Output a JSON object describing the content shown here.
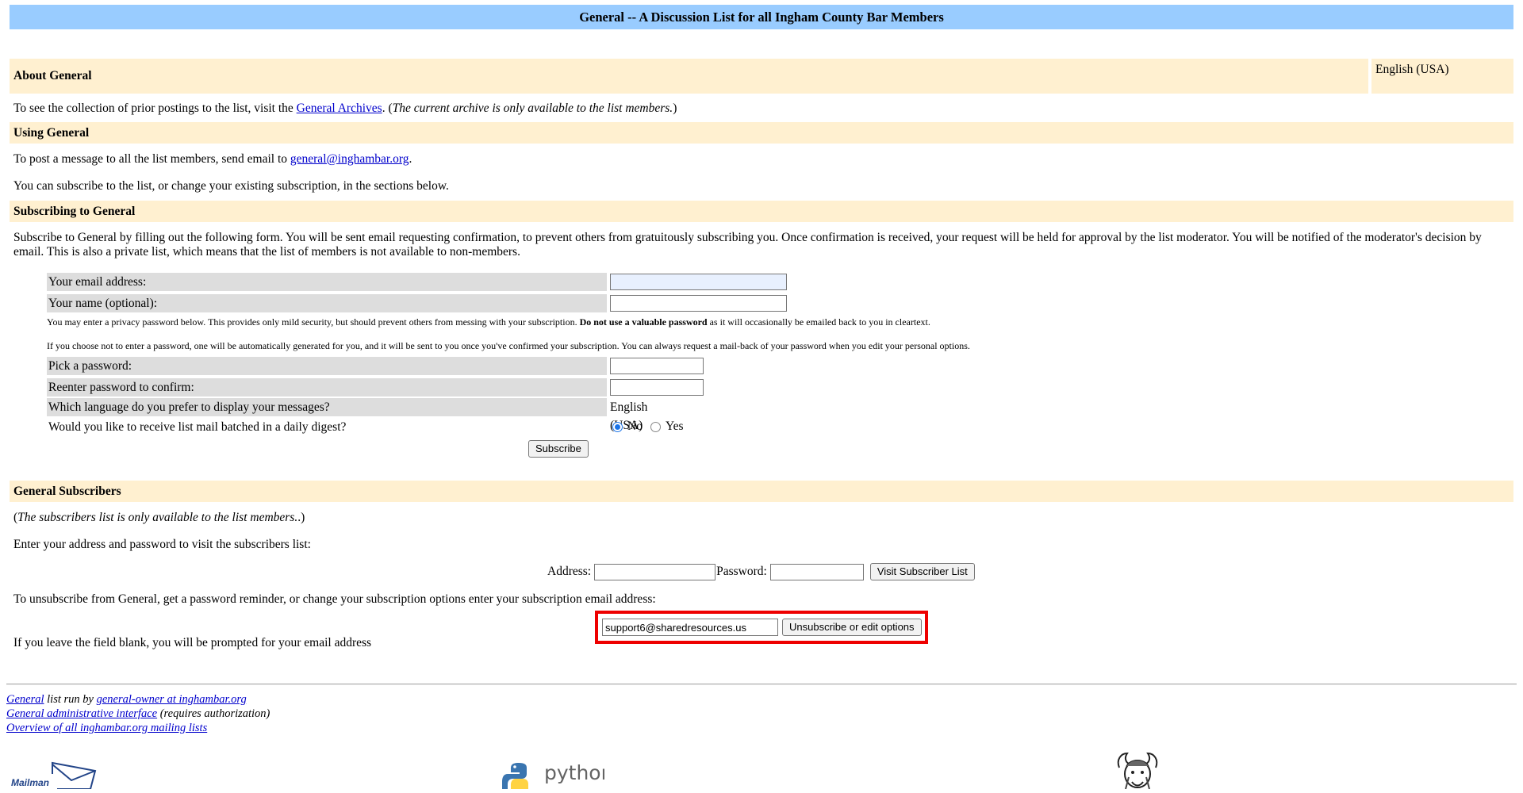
{
  "page": {
    "title": "General -- A Discussion List for all Ingham County Bar Members"
  },
  "about": {
    "heading": "About General",
    "language": "English (USA)",
    "archive_text_pre": "To see the collection of prior postings to the list, visit the ",
    "archive_link": "General Archives",
    "archive_text_post": ". (",
    "archive_note": "The current archive is only available to the list members.",
    "archive_close": ")"
  },
  "using": {
    "heading": "Using General",
    "post_pre": "To post a message to all the list members, send email to ",
    "post_email": "general@inghambar.org",
    "post_post": ".",
    "subscribe_info": "You can subscribe to the list, or change your existing subscription, in the sections below."
  },
  "subscribing": {
    "heading": "Subscribing to General",
    "intro": "Subscribe to General by filling out the following form. You will be sent email requesting confirmation, to prevent others from gratuitously subscribing you. Once confirmation is received, your request will be held for approval by the list moderator. You will be notified of the moderator's decision by email. This is also a private list, which means that the list of members is not available to non-members.",
    "email_label": "Your email address:",
    "email_value": "",
    "name_label": "Your name (optional):",
    "name_value": "",
    "privacy_note_pre": "You may enter a privacy password below. This provides only mild security, but should prevent others from messing with your subscription. ",
    "privacy_note_bold": "Do not use a valuable password",
    "privacy_note_post": " as it will occasionally be emailed back to you in cleartext.",
    "auto_password_note": "If you choose not to enter a password, one will be automatically generated for you, and it will be sent to you once you've confirmed your subscription. You can always request a mail-back of your password when you edit your personal options.",
    "password_label": "Pick a password:",
    "confirm_label": "Reenter password to confirm:",
    "language_label": "Which language do you prefer to display your messages?",
    "language_value": "English (USA)",
    "digest_label": "Would you like to receive list mail batched in a daily digest?",
    "digest_no": "No",
    "digest_yes": "Yes",
    "subscribe_button": "Subscribe"
  },
  "subscribers": {
    "heading": "General Subscribers",
    "private_note": "The subscribers list is only available to the list members.",
    "paren_open": "(",
    "paren_close": ".)",
    "enter_text": "Enter your address and password to visit the subscribers list:",
    "address_label": "Address:",
    "password_label": "Password:",
    "visit_button": "Visit Subscriber List",
    "unsub_text": "To unsubscribe from General, get a password reminder, or change your subscription options enter your subscription email address:",
    "unsub_email_value": "support6@sharedresources.us",
    "unsub_button": "Unsubscribe or edit options",
    "blank_note": "If you leave the field blank, you will be prompted for your email address"
  },
  "footer": {
    "list_link": "General",
    "run_by": " list run by ",
    "owner_link": "general-owner at inghambar.org",
    "admin_link": "General administrative interface",
    "admin_note": " (requires authorization)",
    "overview_link": "Overview of all inghambar.org mailing lists"
  },
  "logos": {
    "mailman_text": "Mailman",
    "python_text": "python"
  },
  "colors": {
    "title_bg": "#99ccff",
    "section_bg": "#fff0d0",
    "label_bg": "#dddddd",
    "highlight": "#ee0000",
    "link": "#0000cc"
  }
}
